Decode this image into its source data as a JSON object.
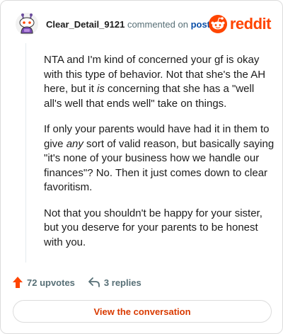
{
  "header": {
    "author": "Clear_Detail_9121",
    "action_text": "commented on",
    "post_link": "post",
    "brand": "reddit"
  },
  "comment": {
    "p1": "NTA and I'm kind of concerned your gf is okay with this type of behavior. Not that she's the AH here, but it ",
    "p1_em": "is",
    "p1_tail": " concerning that she has a \"well all's well that ends well\" take on things.",
    "p2_start": "If only your parents would have had it in them to give ",
    "p2_em": "any",
    "p2_tail": " sort of valid reason, but basically saying \"it's none of your business how we handle our finances\"? No. Then it just comes down to clear favoritism.",
    "p3": "Not that you shouldn't be happy for your sister, but you deserve for your parents to be honest with you."
  },
  "footer": {
    "upvotes": "72 upvotes",
    "replies": "3 replies",
    "view_button": "View the conversation"
  },
  "colors": {
    "brand": "#ff4500",
    "link": "#0a4fa8",
    "muted": "#576f76",
    "view_button_text": "#d93a00"
  },
  "icons": [
    "snoo-avatar-icon",
    "reddit-snoo-icon",
    "upvote-arrow-icon",
    "reply-arrow-icon"
  ]
}
